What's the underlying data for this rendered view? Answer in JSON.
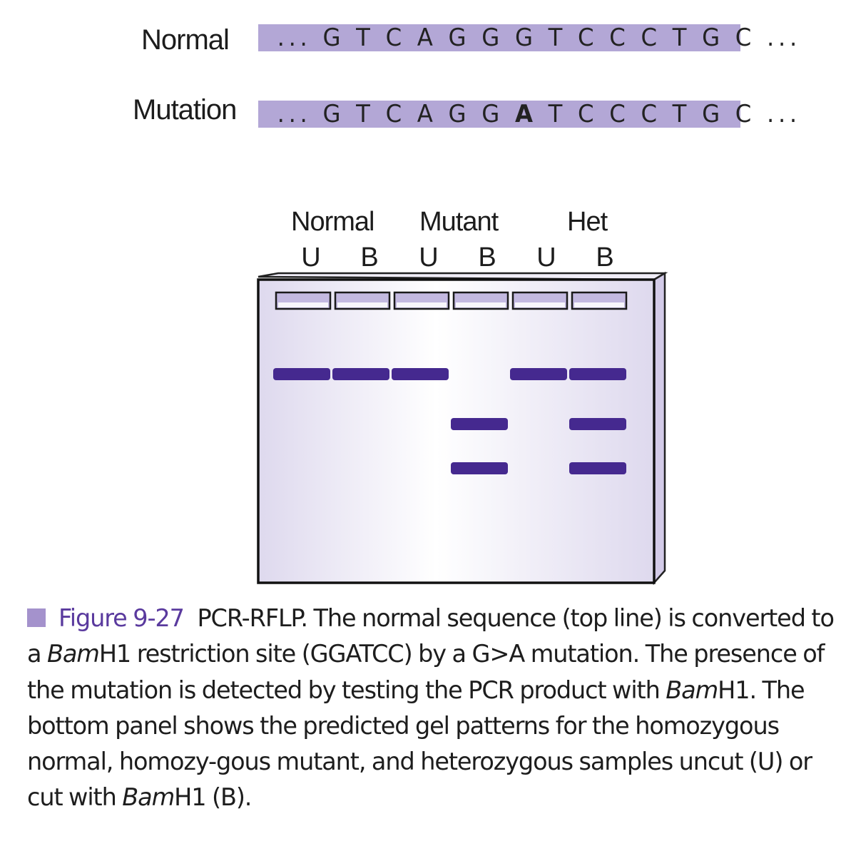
{
  "sequences": {
    "normal": {
      "label": "Normal",
      "prefix": "... ",
      "bases_before": "G T C A G G ",
      "changed": "G",
      "bases_after": " T C C C T G C",
      "suffix": " ..."
    },
    "mutation": {
      "label": "Mutation",
      "prefix": "... ",
      "bases_before": "G T C A G G ",
      "changed": "A",
      "bases_after": " T C C C T G C",
      "suffix": " ..."
    }
  },
  "gel": {
    "groups": [
      "Normal",
      "Mutant",
      "Het"
    ],
    "lanes": [
      {
        "label": "U",
        "group": "Normal",
        "bands": [
          "uncut"
        ]
      },
      {
        "label": "B",
        "group": "Normal",
        "bands": [
          "uncut"
        ]
      },
      {
        "label": "U",
        "group": "Mutant",
        "bands": [
          "uncut"
        ]
      },
      {
        "label": "B",
        "group": "Mutant",
        "bands": [
          "fragment-1",
          "fragment-2"
        ]
      },
      {
        "label": "U",
        "group": "Het",
        "bands": [
          "uncut"
        ]
      },
      {
        "label": "B",
        "group": "Het",
        "bands": [
          "uncut",
          "fragment-1",
          "fragment-2"
        ]
      }
    ],
    "colors": {
      "band": "#45298f",
      "gel_edge": "#c9c0e3",
      "gel_center": "#ffffff",
      "gel_side": "#e3def0"
    }
  },
  "caption": {
    "figure_label": "Figure 9-27",
    "square_color": "#a492cc",
    "part1": "PCR-RFLP. The normal sequence (top line) is converted to a ",
    "enzyme1": "Bam",
    "enzyme1_suffix": "H1",
    "part2": " restriction site (GGATCC) by a G>A mutation. The presence of the mutation is detected by testing the PCR product with ",
    "enzyme2": "Bam",
    "enzyme2_suffix": "H1",
    "part3": ". The bottom panel shows the predicted gel patterns for the homozygous normal, homozy-gous mutant, and heterozygous samples uncut (U) or cut with ",
    "enzyme3": "Bam",
    "enzyme3_suffix": "H1",
    "part4": " (B)."
  }
}
